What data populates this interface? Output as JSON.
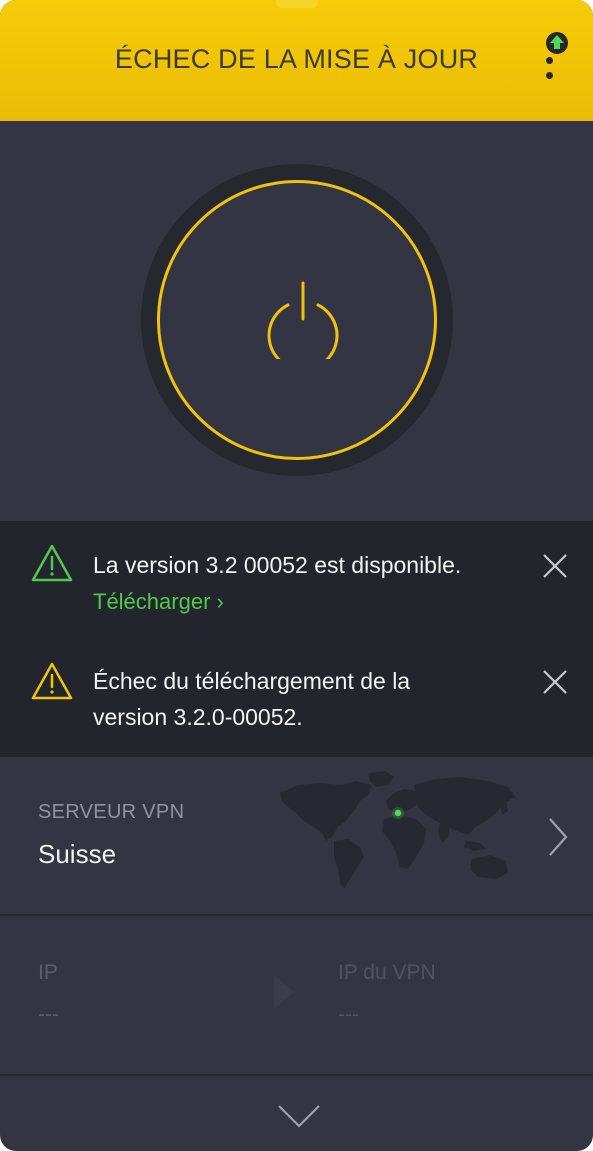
{
  "header": {
    "title": "ÉCHEC DE LA MISE À JOUR",
    "accent_color": "#f2c40b",
    "menu_icon": "vertical-dots-icon",
    "update_icon": "upload-arrow-icon"
  },
  "power": {
    "icon": "power-icon",
    "ring_color": "#f0c20f",
    "state": "disconnected"
  },
  "notifications": [
    {
      "icon": "warning-triangle-icon",
      "icon_color": "#4fc84d",
      "line1": "La version 3.2 00052 est disponible.",
      "link": "Télécharger ›"
    },
    {
      "icon": "warning-triangle-icon",
      "icon_color": "#f0c20f",
      "line1": "Échec du téléchargement de la",
      "line2": "version 3.2.0-00052."
    }
  ],
  "server": {
    "label": "SERVEUR VPN",
    "name": "Suisse",
    "map_icon": "world-map",
    "chevron_icon": "chevron-right-icon"
  },
  "ip": {
    "ip_label": "IP",
    "ip_value": "---",
    "vpn_label": "IP du VPN",
    "vpn_value": "---"
  },
  "footer": {
    "expand_icon": "chevron-down-icon"
  }
}
